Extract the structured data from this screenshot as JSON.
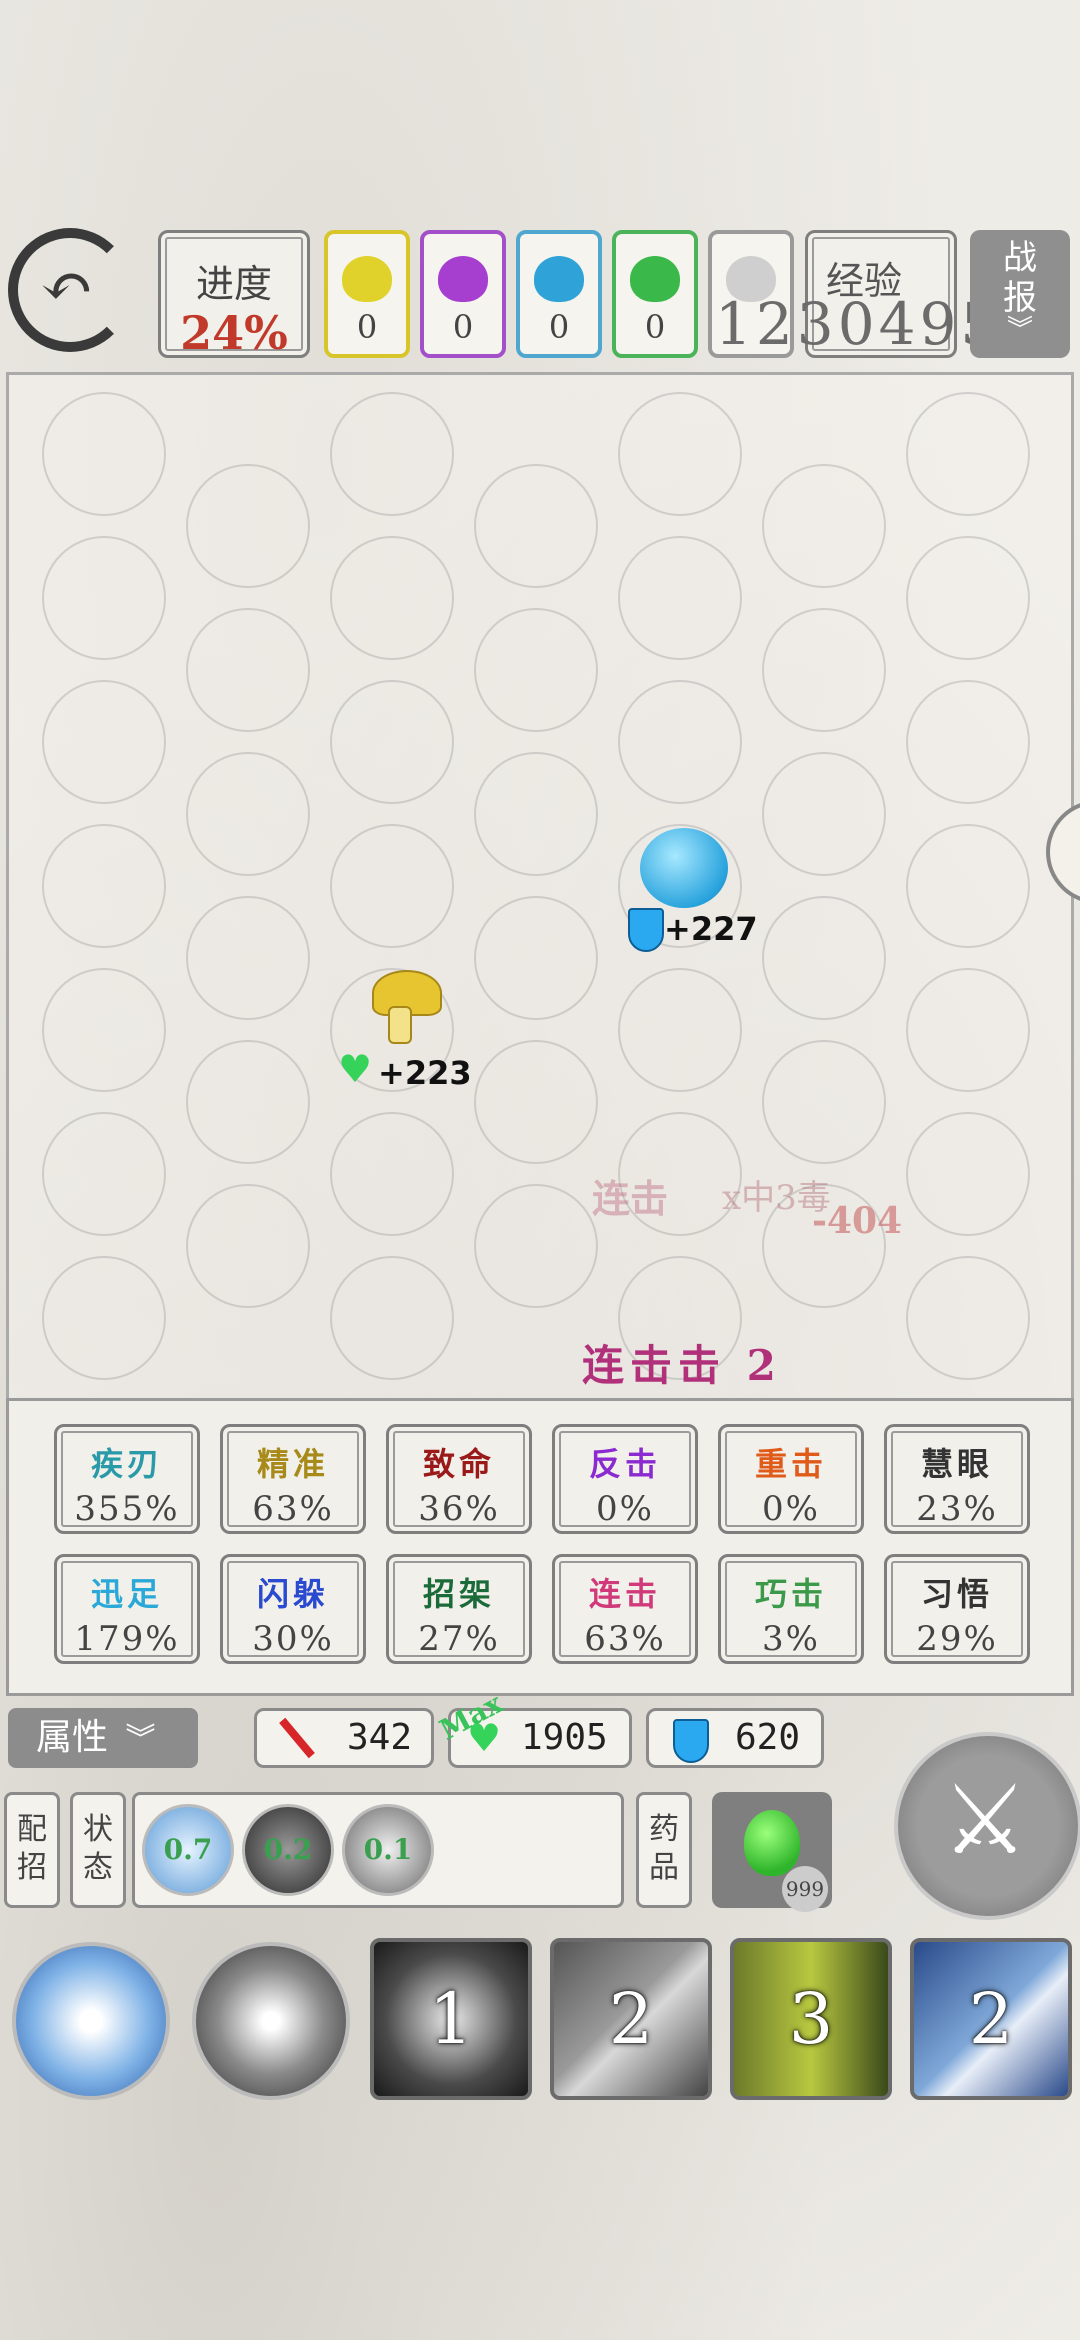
{
  "header": {
    "progress_label": "进度",
    "progress_value": "24%",
    "bags": [
      {
        "color": "#e0d22a",
        "border": "#d8c52a",
        "count": "0"
      },
      {
        "color": "#a63fcf",
        "border": "#a34fc9",
        "count": "0"
      },
      {
        "color": "#2fa3d8",
        "border": "#4fa7cf",
        "count": "0"
      },
      {
        "color": "#3bb84a",
        "border": "#4bb35a",
        "count": "0"
      }
    ],
    "exp_label": "经验",
    "exp_value": "1230495",
    "report_label_1": "战",
    "report_label_2": "报"
  },
  "board": {
    "mushroom_hp": "+223",
    "orb_shield": "+227",
    "float_combo": "连击",
    "float_x": "x中3毒",
    "float_damage": "-404",
    "combo_text": "连击击 2"
  },
  "stats": [
    {
      "name": "疾刃",
      "value": "355%",
      "color": "#2a9aa8"
    },
    {
      "name": "精准",
      "value": "63%",
      "color": "#a88a1a"
    },
    {
      "name": "致命",
      "value": "36%",
      "color": "#9a1a1a"
    },
    {
      "name": "反击",
      "value": "0%",
      "color": "#8a2ad0"
    },
    {
      "name": "重击",
      "value": "0%",
      "color": "#e05a1a"
    },
    {
      "name": "慧眼",
      "value": "23%",
      "color": "#333333"
    },
    {
      "name": "迅足",
      "value": "179%",
      "color": "#2aa8d8"
    },
    {
      "name": "闪躲",
      "value": "30%",
      "color": "#2a4ad0"
    },
    {
      "name": "招架",
      "value": "27%",
      "color": "#1a6a3a"
    },
    {
      "name": "连击",
      "value": "63%",
      "color": "#d03a7a"
    },
    {
      "name": "巧击",
      "value": "3%",
      "color": "#3a9a4a"
    },
    {
      "name": "习悟",
      "value": "29%",
      "color": "#333333"
    }
  ],
  "attributes": {
    "button_label": "属性",
    "attack": "342",
    "hp": "1905",
    "max_tag": "Max",
    "defense": "620"
  },
  "bottom": {
    "config_label": "配招",
    "status_label": "状态",
    "buffs": [
      "0.7",
      "0.2",
      "0.1"
    ],
    "potion_label": "药品",
    "potion_count": "999",
    "skill_cards": [
      "1",
      "2",
      "3",
      "2"
    ]
  }
}
